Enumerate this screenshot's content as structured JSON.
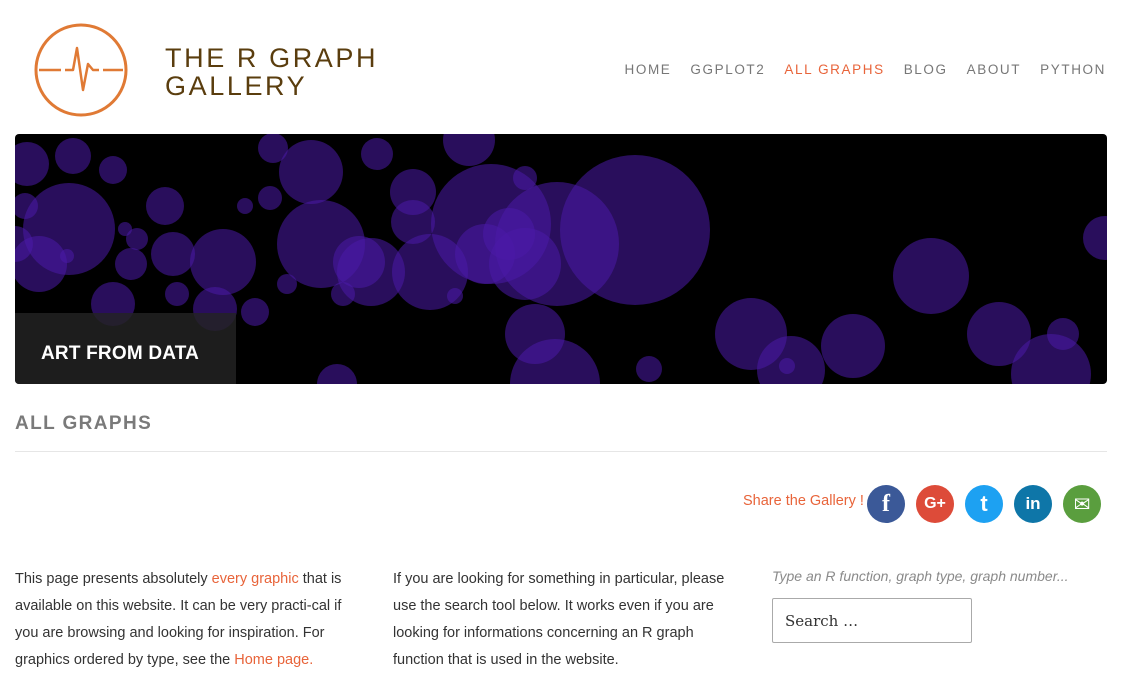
{
  "brand": {
    "line1": "THE R GRAPH",
    "line2": "GALLERY"
  },
  "nav": {
    "items": [
      "HOME",
      "GGPLOT2",
      "ALL GRAPHS",
      "BLOG",
      "ABOUT",
      "PYTHON"
    ],
    "active": "ALL GRAPHS"
  },
  "banner": {
    "label": "ART FROM DATA"
  },
  "page_title": "ALL GRAPHS",
  "share": {
    "label": "Share the Gallery !",
    "buttons": [
      {
        "icon": "facebook-icon",
        "glyph": "f",
        "color": "#3b5998"
      },
      {
        "icon": "google-plus-icon",
        "glyph": "G+",
        "color": "#dd4b39"
      },
      {
        "icon": "twitter-icon",
        "glyph": "t",
        "color": "#1da1f2"
      },
      {
        "icon": "linkedin-icon",
        "glyph": "in",
        "color": "#0e76a8"
      },
      {
        "icon": "email-icon",
        "glyph": "✉",
        "color": "#5a9e3e"
      }
    ]
  },
  "intro": {
    "p1_before": "This page presents absolutely ",
    "p1_link": "every graphic",
    "p1_mid": " that is available on this website. It can be very practi-cal if you are browsing and looking for inspiration. For graphics ordered by type, see the ",
    "p1_link2": "Home page.",
    "p2": "If you are looking for something in particular, please use the search tool below. It works even if you are looking for informations concerning an R graph function that is used in the website."
  },
  "search": {
    "hint": "Type an R function, graph type, graph number...",
    "placeholder": "Search …"
  },
  "colors": {
    "accent": "#e8643a",
    "brand": "#5a3d0e",
    "bubble": "#4b1aa8"
  }
}
